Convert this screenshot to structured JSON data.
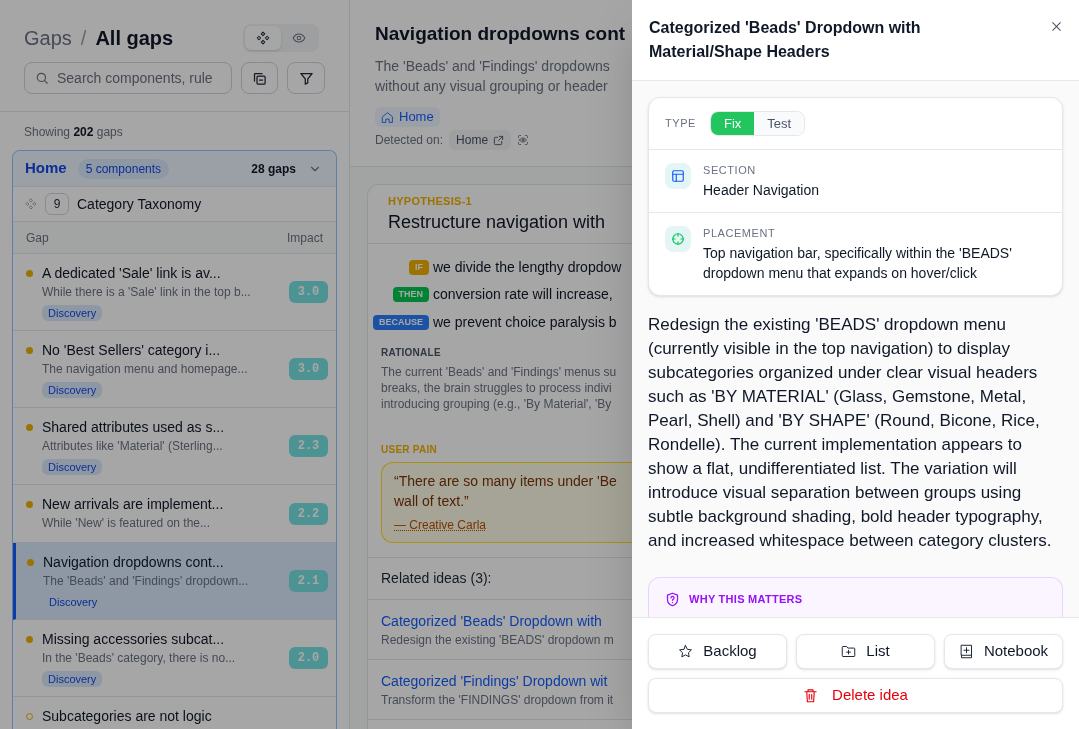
{
  "left_panel": {
    "breadcrumb": {
      "parent": "Gaps",
      "separator": "/",
      "current": "All gaps"
    },
    "view_toggle": [
      {
        "selected": true
      },
      {
        "selected": false
      }
    ],
    "search": {
      "placeholder": "Search components, rule"
    },
    "summary": "Showing **202** gaps",
    "group": {
      "name": "Home",
      "badge": "5 components",
      "count": "28 gaps",
      "expanded": true,
      "component": {
        "count": "9",
        "name": "Category Taxonomy"
      },
      "columns": [
        "Gap",
        "Impact"
      ],
      "items": [
        {
          "title": "A dedicated 'Sale' link is av...",
          "summary": "While there is a 'Sale' link in the top b...",
          "tag": "Discovery",
          "impact": "3.0",
          "filled": true,
          "selected": false
        },
        {
          "title": "No 'Best Sellers' category i...",
          "summary": "The navigation menu and homepage...",
          "tag": "Discovery",
          "impact": "3.0",
          "filled": true,
          "selected": false
        },
        {
          "title": "Shared attributes used as s...",
          "summary": "Attributes like 'Material' (Sterling...",
          "tag": "Discovery",
          "impact": "2.3",
          "filled": true,
          "selected": false
        },
        {
          "title": "New arrivals are implement...",
          "summary": "While 'New' is featured on the...",
          "impact": "2.2",
          "filled": true,
          "selected": false
        },
        {
          "title": "Navigation dropdowns cont...",
          "summary": "The 'Beads' and 'Findings' dropdown...",
          "tag": "Discovery",
          "impact": "2.1",
          "filled": true,
          "selected": true
        },
        {
          "title": "Missing accessories subcat...",
          "summary": "In the 'Beads' category, there is no...",
          "tag": "Discovery",
          "impact": "2.0",
          "filled": true,
          "selected": false
        },
        {
          "title": "Subcategories are not logic",
          "filled": false,
          "selected": false
        }
      ]
    }
  },
  "detail": {
    "title": "Navigation dropdowns cont",
    "description": "The 'Beads' and 'Findings' dropdowns\nwithout any visual grouping or header",
    "page_tag": "Home",
    "detected_label": "Detected on:",
    "detected_page": "Home",
    "hypothesis": {
      "label": "HYPOTHESIS-1",
      "title": "Restructure navigation with",
      "clauses": [
        {
          "kind": "if",
          "keyword": "IF",
          "text": "we divide the lengthy dropdow"
        },
        {
          "kind": "then",
          "keyword": "THEN",
          "text": "conversion rate will increase,"
        },
        {
          "kind": "because",
          "keyword": "BECAUSE",
          "text": "we prevent choice paralysis b"
        }
      ],
      "rationale_label": "RATIONALE",
      "rationale": "The current 'Beads' and 'Findings' menus su\nbreaks, the brain struggles to process indivi\nintroducing grouping (e.g., 'By Material', 'By",
      "pain_label": "USER PAIN",
      "quote": "“There are so many items under 'Be\nwall of text.”",
      "quote_author": "— Creative Carla"
    },
    "related": {
      "heading": "Related ideas (3):",
      "items": [
        {
          "title": "Categorized 'Beads' Dropdown with",
          "summary": "Redesign the existing 'BEADS' dropdown m"
        },
        {
          "title": "Categorized 'Findings' Dropdown wit",
          "summary": "Transform the 'FINDINGS' dropdown from it"
        }
      ]
    }
  },
  "drawer": {
    "title": "Categorized 'Beads' Dropdown with Material/Shape Headers",
    "type_label": "TYPE",
    "type_options": [
      {
        "label": "Fix",
        "selected": true
      },
      {
        "label": "Test",
        "selected": false
      }
    ],
    "fields": [
      {
        "kind": "section",
        "label": "SECTION",
        "value": "Header Navigation"
      },
      {
        "kind": "placement",
        "label": "PLACEMENT",
        "value": "Top navigation bar, specifically within the 'BEADS' dropdown menu that expands on hover/click"
      }
    ],
    "description": "Redesign the existing 'BEADS' dropdown menu (currently visible in the top navigation) to display subcategories organized under clear visual headers such as 'BY MATERIAL' (Glass, Gemstone, Metal, Pearl, Shell) and 'BY SHAPE' (Round, Bicone, Rice, Rondelle). The current implementation appears to show a flat, undifferentiated list. The variation will introduce visual separation between groups using subtle background shading, bold header typography, and increased whitespace between category clusters.",
    "why_heading": "WHY THIS MATTERS",
    "actions": [
      {
        "kind": "backlog",
        "label": "Backlog"
      },
      {
        "kind": "list",
        "label": "List"
      },
      {
        "kind": "notebook",
        "label": "Notebook"
      }
    ],
    "delete_label": "Delete idea"
  }
}
